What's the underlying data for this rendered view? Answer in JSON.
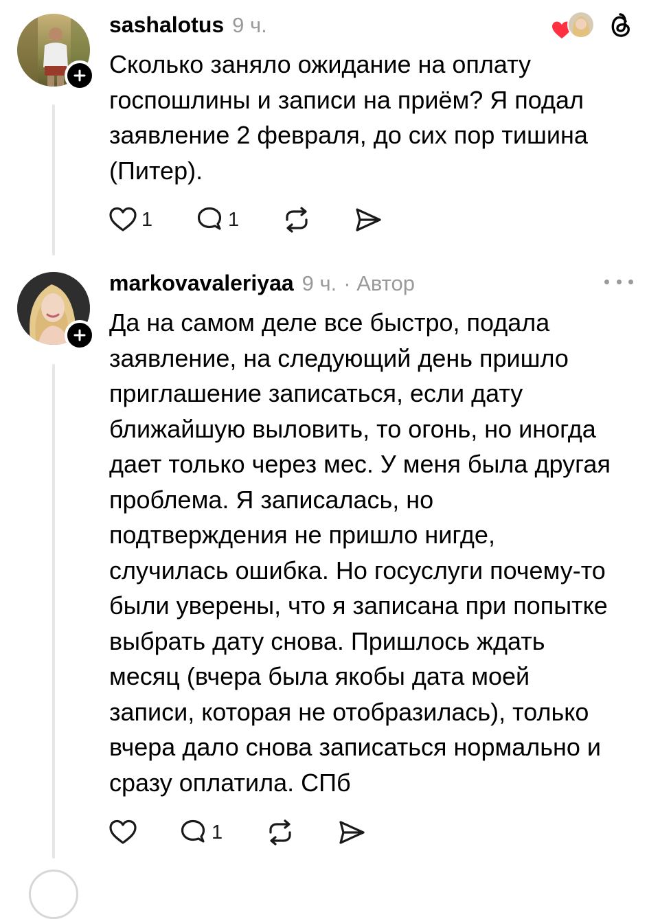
{
  "posts": [
    {
      "username": "sashalotus",
      "time": "9 ч.",
      "author_tag": "",
      "text": "Сколько заняло ожидание на оплату\nгоспошлины и записи на приём? Я подал\nзаявление 2 февраля, до сих пор тишина\n(Питер).",
      "likes": "1",
      "replies": "1"
    },
    {
      "username": "markovavaleriyaa",
      "time": "9 ч.",
      "author_tag": "· Автор",
      "text": "Да на самом деле все быстро, подала\nзаявление, на следующий день пришло\nприглашение записаться, если дату\nближайшую выловить, то огонь, но иногда\nдает только через мес. У меня была другая\nпроблема. Я записалась, но\nподтверждения не пришло нигде,\nслучилась ошибка. Но госуслуги почему-то\nбыли уверены, что я записана при попытке\nвыбрать дату снова. Пришлось ждать\nмесяц (вчера была якобы дата моей\nзаписи, которая не отобразилась), только\nвчера дало снова записаться нормально и\nсразу оплатила. СПб",
      "likes": "",
      "replies": "1"
    }
  ],
  "icons": {
    "like": "heart-icon",
    "reply": "comment-icon",
    "repost": "repost-icon",
    "share": "send-icon",
    "follow": "plus-icon",
    "threads": "threads-logo-icon",
    "more": "more-icon"
  },
  "colors": {
    "liked_heart": "#ff3040",
    "meta_gray": "#9a9a9a",
    "thread_line": "#e6e6e6"
  }
}
